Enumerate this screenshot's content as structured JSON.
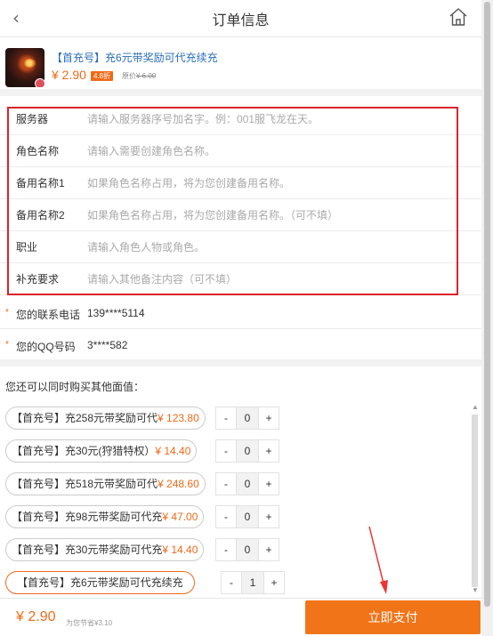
{
  "header": {
    "title": "订单信息",
    "back_icon": "chevron-left-icon",
    "home_icon": "home-icon"
  },
  "product": {
    "title": "【首充号】充6元带奖励可代充续充",
    "price": "¥ 2.90",
    "discount": "4.8折",
    "original_price_label": "原价",
    "original_price": "¥ 6.00"
  },
  "form": {
    "fields": [
      {
        "label": "服务器",
        "placeholder": "请输入服务器序号加名字。例：001服飞龙在天。",
        "value": ""
      },
      {
        "label": "角色名称",
        "placeholder": "请输入需要创建角色名称。",
        "value": ""
      },
      {
        "label": "备用名称1",
        "placeholder": "如果角色名称占用，将为您创建备用名称。",
        "value": ""
      },
      {
        "label": "备用名称2",
        "placeholder": "如果角色名称占用，将为您创建备用名称。（可不填）",
        "value": ""
      },
      {
        "label": "职业",
        "placeholder": "请输入角色人物或角色。",
        "value": ""
      },
      {
        "label": "补充要求",
        "placeholder": "请输入其他备注内容（可不填）",
        "value": ""
      }
    ]
  },
  "contact": {
    "star": "*",
    "phone_label": "您的联系电话",
    "phone_value": "139****5114",
    "qq_label": "您的QQ号码",
    "qq_value": "3****582"
  },
  "addons": {
    "heading": "您还可以同时购买其他面值：",
    "items": [
      {
        "name": "【首充号】充258元带奖励可代",
        "price": "¥ 123.80",
        "qty": "0",
        "active": false
      },
      {
        "name": "【首充号】充30元(狩猎特权）",
        "price": "¥ 14.40",
        "qty": "0",
        "active": false
      },
      {
        "name": "【首充号】充518元带奖励可代",
        "price": "¥ 248.60",
        "qty": "0",
        "active": false
      },
      {
        "name": "【首充号】充98元带奖励可代充",
        "price": "¥ 47.00",
        "qty": "0",
        "active": false
      },
      {
        "name": "【首充号】充30元带奖励可代充",
        "price": "¥ 14.40",
        "qty": "0",
        "active": false
      },
      {
        "name": "【首充号】充6元带奖励可代充续充",
        "price": "",
        "qty": "1",
        "active": true
      }
    ],
    "minus": "-",
    "plus": "+"
  },
  "footer": {
    "total": "¥ 2.90",
    "savings": "为您节省¥3.10",
    "pay_label": "立即支付"
  },
  "colors": {
    "accent": "#f06a1a",
    "link": "#2a6ebb",
    "highlight_box": "#d9232d"
  }
}
